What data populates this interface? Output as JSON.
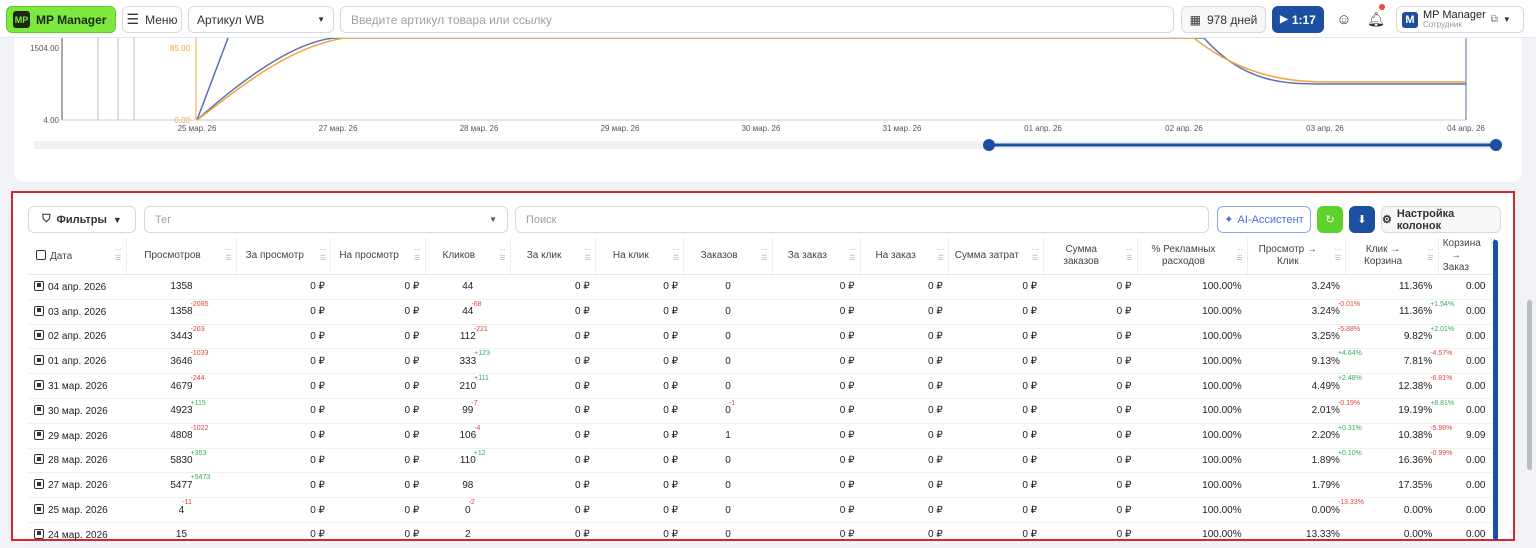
{
  "topbar": {
    "logo_label": "MP Manager",
    "menu_label": "Меню",
    "article_select": "Артикул WB",
    "search_placeholder": "Введите артикул товара или ссылку",
    "days_label": "978 дней",
    "video_label": "1:17",
    "user_name": "MP Manager",
    "user_role": "Сотрудник",
    "user_initial": "M"
  },
  "chart_data": {
    "type": "line",
    "x_ticks": [
      "25 мар. 26",
      "27 мар. 26",
      "28 мар. 26",
      "29 мар. 26",
      "30 мар. 26",
      "31 мар. 26",
      "01 апр. 26",
      "02 апр. 26",
      "03 апр. 26",
      "04 апр. 26"
    ],
    "y_ticks_left": [
      "1504.00",
      "4.00"
    ],
    "y_ticks_left2": [
      "85.00",
      "0.00"
    ],
    "colors": {
      "series1": "#5b6fb4",
      "series2": "#f2a540"
    }
  },
  "toolbar": {
    "filters_label": "Фильтры",
    "tag_placeholder": "Тег",
    "search_placeholder": "Поиск",
    "ai_label": "AI-Ассистент",
    "columns_label": "Настройка колонок"
  },
  "table": {
    "headers": [
      "Дата",
      "Просмотров",
      "За просмотр",
      "На просмотр",
      "Кликов",
      "За клик",
      "На клик",
      "Заказов",
      "За заказ",
      "На заказ",
      "Сумма затрат",
      "Сумма заказов",
      "% Рекламных расходов",
      "Просмотр → Клик",
      "Клик → Корзина",
      "Корзина → Заказ"
    ],
    "rows": [
      {
        "date": "04 апр. 2026",
        "views": "1358",
        "views_d": "",
        "zp": "0 ₽",
        "np": "0 ₽",
        "clicks": "44",
        "clicks_d": "",
        "zk": "0 ₽",
        "nk": "0 ₽",
        "orders": "0",
        "orders_d": "",
        "zz": "0 ₽",
        "nz": "0 ₽",
        "cost": "0 ₽",
        "sum": "0 ₽",
        "pct": "100.00%",
        "vc": "3.24%",
        "vc_d": "",
        "kc": "11.36%",
        "kc_d": "",
        "co": "0.00"
      },
      {
        "date": "03 апр. 2026",
        "views": "1358",
        "views_d": "-2085",
        "zp": "0 ₽",
        "np": "0 ₽",
        "clicks": "44",
        "clicks_d": "-68",
        "zk": "0 ₽",
        "nk": "0 ₽",
        "orders": "0",
        "orders_d": "",
        "zz": "0 ₽",
        "nz": "0 ₽",
        "cost": "0 ₽",
        "sum": "0 ₽",
        "pct": "100.00%",
        "vc": "3.24%",
        "vc_d": "-0.01%",
        "kc": "11.36%",
        "kc_d": "+1.54%",
        "co": "0.00"
      },
      {
        "date": "02 апр. 2026",
        "views": "3443",
        "views_d": "-203",
        "zp": "0 ₽",
        "np": "0 ₽",
        "clicks": "112",
        "clicks_d": "-221",
        "zk": "0 ₽",
        "nk": "0 ₽",
        "orders": "0",
        "orders_d": "",
        "zz": "0 ₽",
        "nz": "0 ₽",
        "cost": "0 ₽",
        "sum": "0 ₽",
        "pct": "100.00%",
        "vc": "3.25%",
        "vc_d": "-5.88%",
        "kc": "9.82%",
        "kc_d": "+2.01%",
        "co": "0.00"
      },
      {
        "date": "01 апр. 2026",
        "views": "3646",
        "views_d": "-1033",
        "zp": "0 ₽",
        "np": "0 ₽",
        "clicks": "333",
        "clicks_d": "+123",
        "zk": "0 ₽",
        "nk": "0 ₽",
        "orders": "0",
        "orders_d": "",
        "zz": "0 ₽",
        "nz": "0 ₽",
        "cost": "0 ₽",
        "sum": "0 ₽",
        "pct": "100.00%",
        "vc": "9.13%",
        "vc_d": "+4.64%",
        "kc": "7.81%",
        "kc_d": "-4.57%",
        "co": "0.00"
      },
      {
        "date": "31 мар. 2026",
        "views": "4679",
        "views_d": "-244",
        "zp": "0 ₽",
        "np": "0 ₽",
        "clicks": "210",
        "clicks_d": "+111",
        "zk": "0 ₽",
        "nk": "0 ₽",
        "orders": "0",
        "orders_d": "",
        "zz": "0 ₽",
        "nz": "0 ₽",
        "cost": "0 ₽",
        "sum": "0 ₽",
        "pct": "100.00%",
        "vc": "4.49%",
        "vc_d": "+2.48%",
        "kc": "12.38%",
        "kc_d": "-6.81%",
        "co": "0.00"
      },
      {
        "date": "30 мар. 2026",
        "views": "4923",
        "views_d": "+115",
        "zp": "0 ₽",
        "np": "0 ₽",
        "clicks": "99",
        "clicks_d": "-7",
        "zk": "0 ₽",
        "nk": "0 ₽",
        "orders": "0",
        "orders_d": "-1",
        "zz": "0 ₽",
        "nz": "0 ₽",
        "cost": "0 ₽",
        "sum": "0 ₽",
        "pct": "100.00%",
        "vc": "2.01%",
        "vc_d": "-0.19%",
        "kc": "19.19%",
        "kc_d": "+8.81%",
        "co": "0.00"
      },
      {
        "date": "29 мар. 2026",
        "views": "4808",
        "views_d": "-1022",
        "zp": "0 ₽",
        "np": "0 ₽",
        "clicks": "106",
        "clicks_d": "-4",
        "zk": "0 ₽",
        "nk": "0 ₽",
        "orders": "1",
        "orders_d": "",
        "zz": "0 ₽",
        "nz": "0 ₽",
        "cost": "0 ₽",
        "sum": "0 ₽",
        "pct": "100.00%",
        "vc": "2.20%",
        "vc_d": "+0.31%",
        "kc": "10.38%",
        "kc_d": "-5.98%",
        "co": "9.09"
      },
      {
        "date": "28 мар. 2026",
        "views": "5830",
        "views_d": "+353",
        "zp": "0 ₽",
        "np": "0 ₽",
        "clicks": "110",
        "clicks_d": "+12",
        "zk": "0 ₽",
        "nk": "0 ₽",
        "orders": "0",
        "orders_d": "",
        "zz": "0 ₽",
        "nz": "0 ₽",
        "cost": "0 ₽",
        "sum": "0 ₽",
        "pct": "100.00%",
        "vc": "1.89%",
        "vc_d": "+0.10%",
        "kc": "16.36%",
        "kc_d": "-0.99%",
        "co": "0.00"
      },
      {
        "date": "27 мар. 2026",
        "views": "5477",
        "views_d": "+5473",
        "zp": "0 ₽",
        "np": "0 ₽",
        "clicks": "98",
        "clicks_d": "",
        "zk": "0 ₽",
        "nk": "0 ₽",
        "orders": "0",
        "orders_d": "",
        "zz": "0 ₽",
        "nz": "0 ₽",
        "cost": "0 ₽",
        "sum": "0 ₽",
        "pct": "100.00%",
        "vc": "1.79%",
        "vc_d": "",
        "kc": "17.35%",
        "kc_d": "",
        "co": "0.00"
      },
      {
        "date": "25 мар. 2026",
        "views": "4",
        "views_d": "-11",
        "zp": "0 ₽",
        "np": "0 ₽",
        "clicks": "0",
        "clicks_d": "-2",
        "zk": "0 ₽",
        "nk": "0 ₽",
        "orders": "0",
        "orders_d": "",
        "zz": "0 ₽",
        "nz": "0 ₽",
        "cost": "0 ₽",
        "sum": "0 ₽",
        "pct": "100.00%",
        "vc": "0.00%",
        "vc_d": "-13.33%",
        "kc": "0.00%",
        "kc_d": "",
        "co": "0.00"
      },
      {
        "date": "24 мар. 2026",
        "views": "15",
        "views_d": "",
        "zp": "0 ₽",
        "np": "0 ₽",
        "clicks": "2",
        "clicks_d": "",
        "zk": "0 ₽",
        "nk": "0 ₽",
        "orders": "0",
        "orders_d": "",
        "zz": "0 ₽",
        "nz": "0 ₽",
        "cost": "0 ₽",
        "sum": "0 ₽",
        "pct": "100.00%",
        "vc": "13.33%",
        "vc_d": "",
        "kc": "0.00%",
        "kc_d": "",
        "co": "0.00"
      }
    ]
  }
}
